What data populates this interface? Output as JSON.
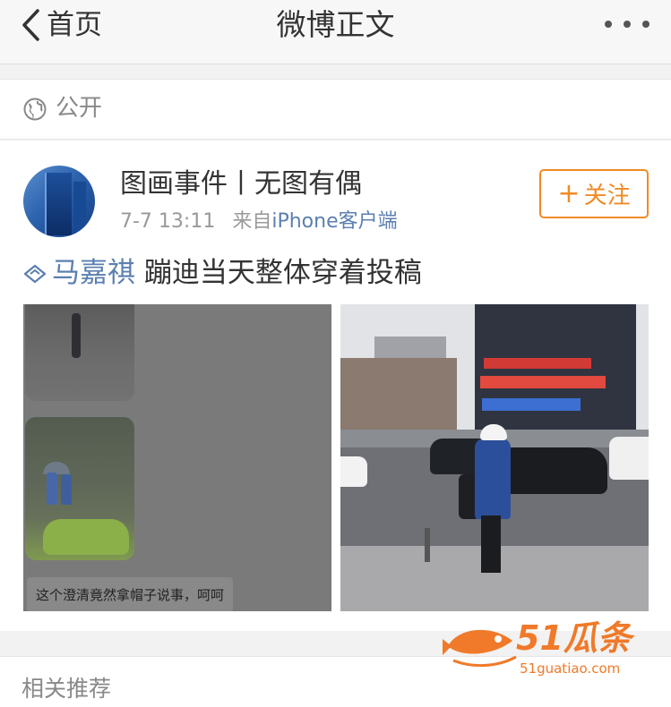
{
  "navbar": {
    "back_label": "首页",
    "title": "微博正文"
  },
  "privacy": {
    "label": "公开"
  },
  "post": {
    "author": "图画事件丨无图有偶",
    "time": "7-7 13:11",
    "source_prefix": "来自",
    "source": "iPhone客户端",
    "follow_label": "关注",
    "topic": "马嘉祺",
    "text": " 蹦迪当天整体穿着投稿",
    "image1_caption": "这个澄清竟然拿帽子说事，呵呵"
  },
  "related": {
    "label": "相关推荐"
  },
  "watermark": {
    "text": "51瓜条",
    "url": "51guatiao.com"
  },
  "colors": {
    "accent": "#f08a24",
    "link": "#5b7fb0"
  }
}
